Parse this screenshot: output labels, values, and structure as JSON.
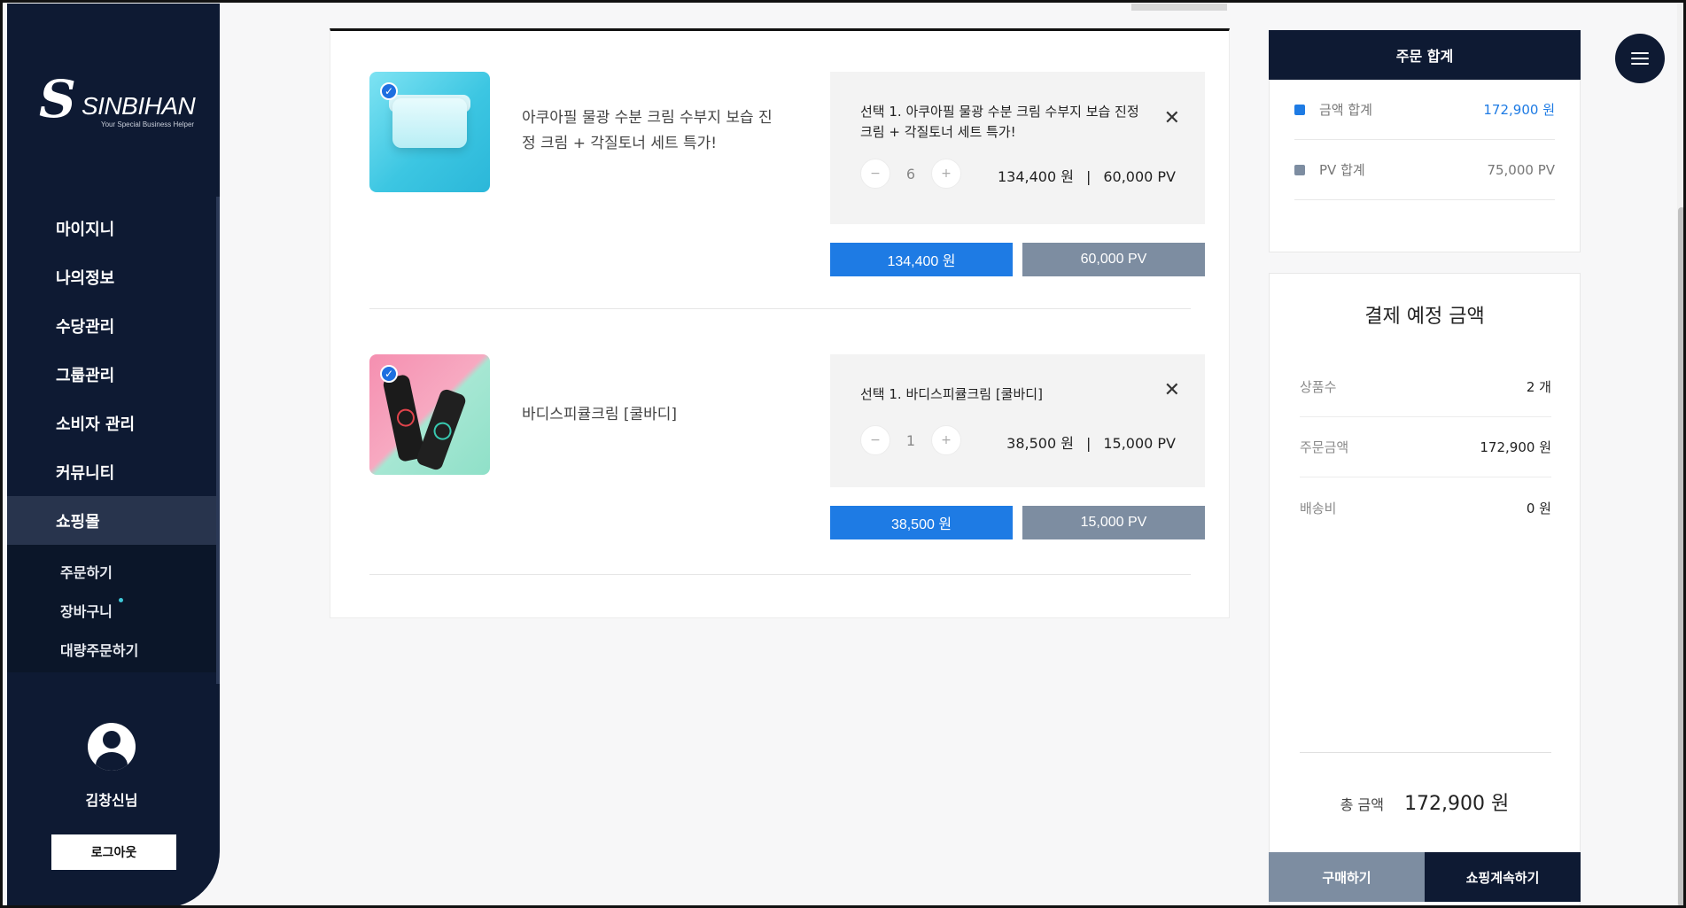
{
  "sidebar": {
    "logo": {
      "mark": "S",
      "brand": "SINBIHAN",
      "tagline": "Your Special Business Helper"
    },
    "nav": [
      {
        "label": "마이지니"
      },
      {
        "label": "나의정보"
      },
      {
        "label": "수당관리"
      },
      {
        "label": "그룹관리"
      },
      {
        "label": "소비자 관리"
      },
      {
        "label": "커뮤니티"
      },
      {
        "label": "쇼핑몰"
      }
    ],
    "subnav": [
      {
        "label": "주문하기"
      },
      {
        "label": "장바구니"
      },
      {
        "label": "대량주문하기"
      }
    ],
    "user": {
      "name": "김창신님"
    },
    "logout_label": "로그아웃"
  },
  "cart": {
    "items": [
      {
        "name": "아쿠아필 물광 수분 크림 수부지 보습 진정 크림 + 각질토너 세트 특가!",
        "option_title": "선택 1. 아쿠아필 물광 수분 크림 수부지 보습 진정 크림 + 각질토너 세트 특가!",
        "qty": "6",
        "price": "134,400 원",
        "pv": "60,000 PV",
        "total_won": "134,400 원",
        "total_pv": "60,000 PV",
        "checked": true
      },
      {
        "name": "바디스피큘크림 [쿨바디]",
        "option_title": "선택 1. 바디스피큘크림 [쿨바디]",
        "qty": "1",
        "price": "38,500 원",
        "pv": "15,000 PV",
        "total_won": "38,500 원",
        "total_pv": "15,000 PV",
        "checked": true
      }
    ],
    "separator": "|",
    "minus": "−",
    "plus": "+",
    "close": "✕",
    "check": "✓"
  },
  "summary": {
    "title": "주문 합계",
    "amount_label": "금액 합계",
    "amount_value": "172,900 원",
    "pv_label": "PV 합계",
    "pv_value": "75,000 PV",
    "colors": {
      "amount": "#1e7be4",
      "pv": "#7d8da1"
    }
  },
  "payment": {
    "title": "결제 예정 금액",
    "rows": [
      {
        "label": "상품수",
        "value": "2 개"
      },
      {
        "label": "주문금액",
        "value": "172,900 원"
      },
      {
        "label": "배송비",
        "value": "0 원"
      }
    ],
    "total_label": "총 금액",
    "total_value": "172,900 원",
    "buy_label": "구매하기",
    "continue_label": "쇼핑계속하기"
  },
  "icons": {
    "menu": "hamburger-icon",
    "close": "close-icon",
    "check": "check-icon",
    "avatar": "user-avatar-icon"
  }
}
